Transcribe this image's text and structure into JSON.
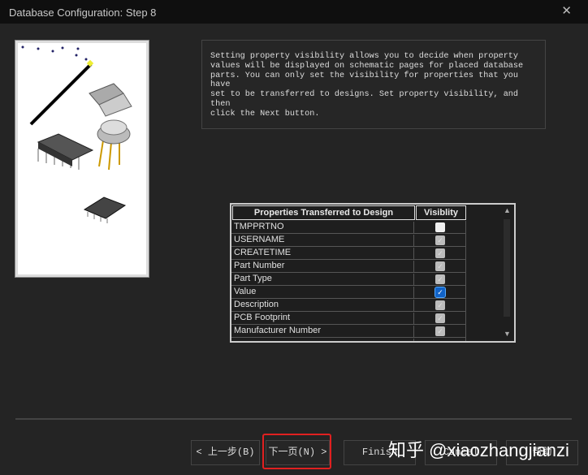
{
  "window": {
    "title": "Database Configuration: Step 8",
    "close_icon": "close-icon"
  },
  "description": "Setting property visibility allows you to decide when property\nvalues will be displayed on schematic pages for placed database\nparts. You can only set the visibility for properties that you have\nset to be transferred to designs. Set property visibility, and then\nclick the Next button.",
  "table": {
    "headers": [
      "Properties Transferred to Design",
      "Visiblity"
    ],
    "rows": [
      {
        "name": "TMPPRTNO",
        "visible": false,
        "enabled": true
      },
      {
        "name": "USERNAME",
        "visible": true,
        "enabled": false
      },
      {
        "name": "CREATETIME",
        "visible": true,
        "enabled": false
      },
      {
        "name": "Part Number",
        "visible": true,
        "enabled": false
      },
      {
        "name": "Part Type",
        "visible": true,
        "enabled": false
      },
      {
        "name": "Value",
        "visible": true,
        "enabled": true
      },
      {
        "name": "Description",
        "visible": true,
        "enabled": false
      },
      {
        "name": "PCB Footprint",
        "visible": true,
        "enabled": false
      },
      {
        "name": "Manufacturer Number",
        "visible": true,
        "enabled": false
      }
    ]
  },
  "buttons": {
    "back": "< 上一步(B)",
    "next": "下一页(N) >",
    "finish": "Finish",
    "cancel": "Cancel",
    "help": "帮助"
  },
  "watermark": "知乎 @xiaozhangjianzi",
  "colors": {
    "highlight": "#e02020",
    "checked": "#1163c8"
  }
}
